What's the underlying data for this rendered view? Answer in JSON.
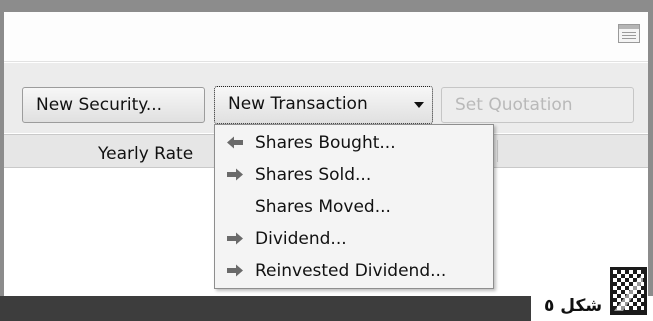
{
  "toolbar": {
    "table_view_icon": "table-view-icon"
  },
  "buttons": {
    "new_security": "New Security...",
    "new_transaction": "New Transaction",
    "set_quotation": "Set Quotation"
  },
  "columns": {
    "yearly_rate": "Yearly Rate"
  },
  "menu": {
    "items": [
      {
        "label": "Shares Bought...",
        "icon": "arrow-left-icon"
      },
      {
        "label": "Shares Sold...",
        "icon": "arrow-right-icon"
      },
      {
        "label": "Shares Moved...",
        "icon": ""
      },
      {
        "label": "Dividend...",
        "icon": "arrow-right-icon"
      },
      {
        "label": "Reinvested Dividend...",
        "icon": "arrow-right-icon"
      }
    ]
  },
  "caption": {
    "text": "شكل ٥"
  },
  "colors": {
    "window_bg": "#ececec",
    "frame": "#8c8c8c",
    "dark_bar": "#3d3d3d",
    "disabled_text": "#b9b9b9"
  }
}
